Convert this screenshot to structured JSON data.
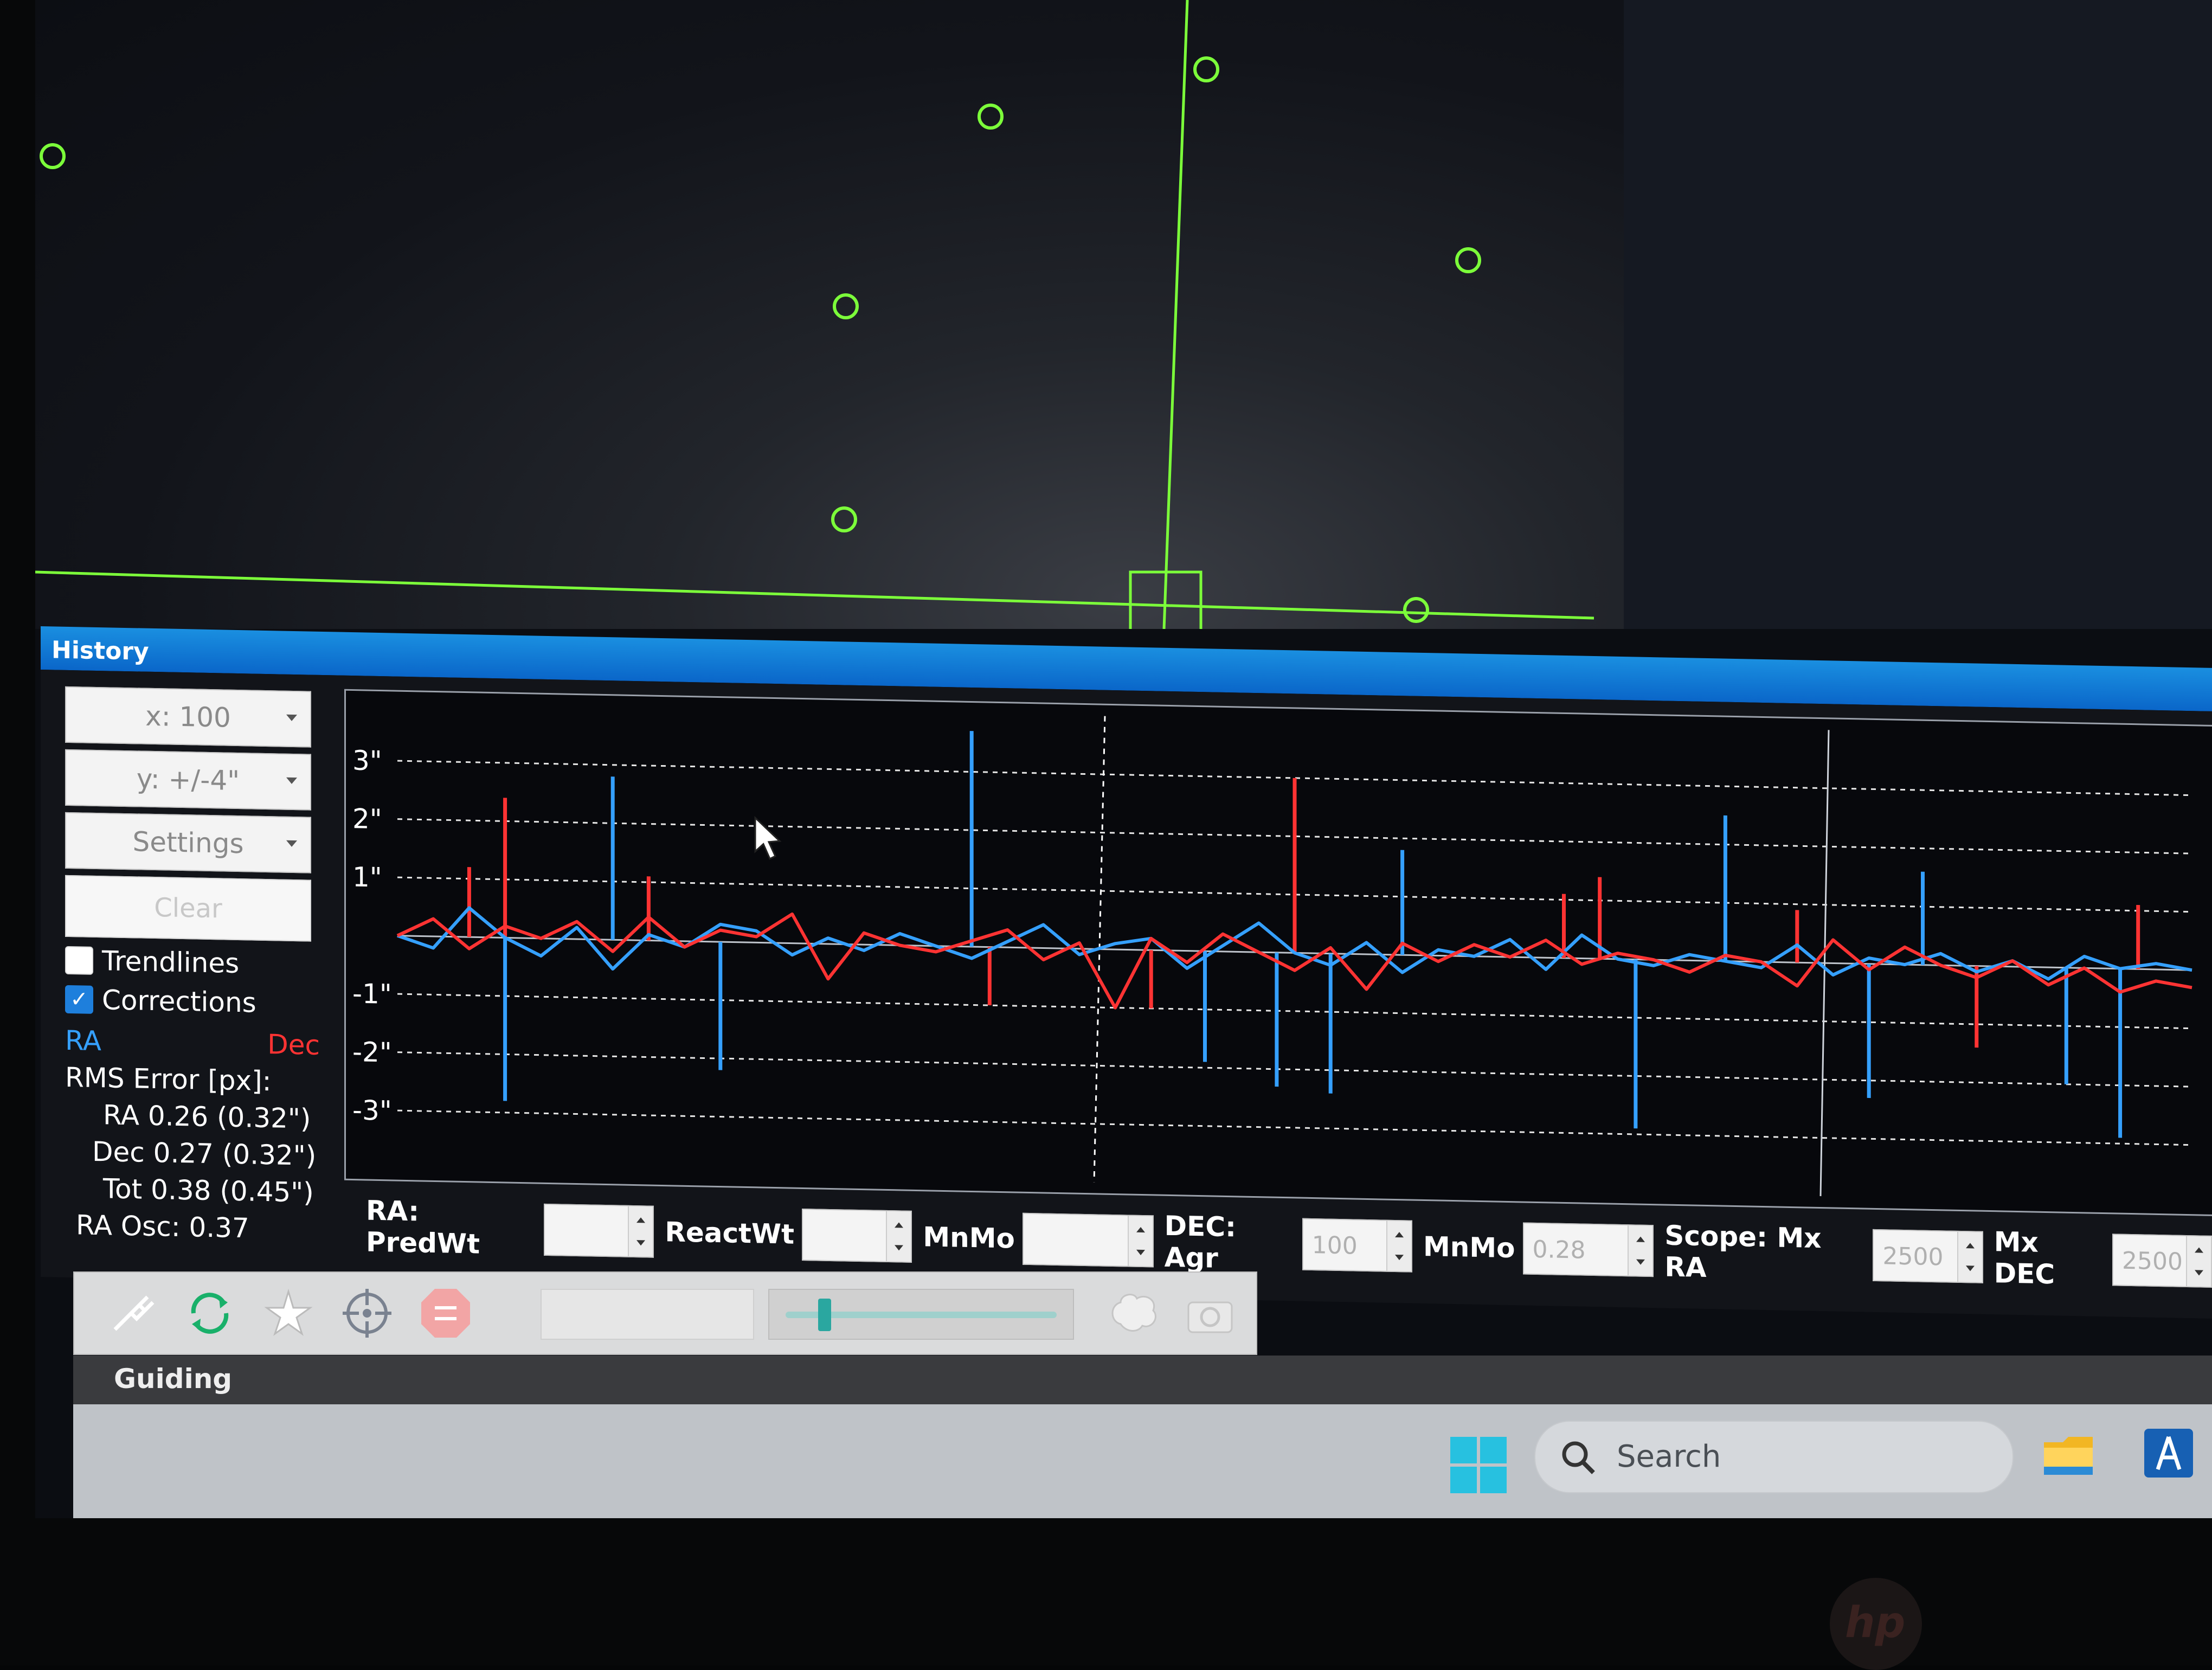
{
  "history": {
    "title": "History",
    "x_scale": "x: 100",
    "y_scale": "y: +/-4\"",
    "settings": "Settings",
    "clear": "Clear",
    "trendlines": {
      "label": "Trendlines",
      "checked": false
    },
    "corrections": {
      "label": "Corrections",
      "checked": true
    },
    "legend_ra": "RA",
    "legend_dec": "Dec",
    "rms_title": "RMS Error [px]:",
    "rms_ra": "RA 0.26 (0.32\")",
    "rms_dec": "Dec 0.27 (0.32\")",
    "rms_tot": "Tot 0.38 (0.45\")",
    "ra_osc": "RA Osc: 0.37"
  },
  "params": {
    "ra_label": "RA: PredWt",
    "ra_predwt": "",
    "reactwt_label": "ReactWt",
    "ra_reactwt": "",
    "ra_mnmo_label": "MnMo",
    "ra_mnmo": "",
    "dec_label": "DEC: Agr",
    "dec_agr": "100",
    "dec_mnmo_label": "MnMo",
    "dec_mnmo": "0.28",
    "scope_label": "Scope: Mx RA",
    "mx_ra": "2500",
    "mx_dec_label": "Mx DEC",
    "mx_dec": "2500"
  },
  "guiding": {
    "label": "Guiding"
  },
  "taskbar": {
    "search_label": "Search"
  },
  "icons": {
    "toolbar": [
      "usb-plug-icon",
      "loop-icon",
      "auto-select-star-icon",
      "guide-crosshair-icon",
      "stop-icon",
      "brain-icon",
      "camera-icon"
    ],
    "taskbar": [
      "windows-start-icon",
      "search-icon",
      "file-explorer-icon",
      "ascom-icon",
      "phd2-icon"
    ]
  },
  "colors": {
    "ra": "#35a0ff",
    "dec": "#ff3333",
    "overlay": "#7cff3a",
    "title_bar": "#0a66c9"
  },
  "chart_data": {
    "type": "line",
    "y_unit": "arcsec",
    "ytick_labels": [
      "3\"",
      "2\"",
      "1\"",
      "-1\"",
      "-2\"",
      "-3\""
    ],
    "ytick_values": [
      3,
      2,
      1,
      -1,
      -2,
      -3
    ],
    "ylim": [
      -4,
      4
    ],
    "xlim": [
      0,
      100
    ],
    "grid": true,
    "series": [
      {
        "key": "ra",
        "name": "RA",
        "x": [
          0,
          2,
          4,
          6,
          8,
          10,
          12,
          14,
          16,
          18,
          20,
          22,
          24,
          26,
          28,
          30,
          32,
          34,
          36,
          38,
          40,
          42,
          44,
          46,
          48,
          50,
          52,
          54,
          56,
          58,
          60,
          62,
          64,
          66,
          68,
          70,
          72,
          74,
          76,
          78,
          80,
          82,
          84,
          86,
          88,
          90,
          92,
          94,
          96,
          98,
          100
        ],
        "values": [
          0,
          -0.2,
          0.5,
          0,
          -0.3,
          0.2,
          -0.5,
          0.1,
          -0.1,
          0.3,
          0.2,
          -0.2,
          0.1,
          -0.1,
          0.2,
          0,
          -0.2,
          0.1,
          0.4,
          -0.1,
          0.1,
          0.2,
          -0.3,
          0.1,
          0.5,
          0,
          -0.2,
          0.2,
          -0.3,
          0.1,
          0,
          0.3,
          -0.2,
          0.4,
          0,
          -0.1,
          0.1,
          0,
          -0.1,
          0.3,
          -0.2,
          0.1,
          0,
          0.2,
          -0.1,
          0.1,
          -0.2,
          0.2,
          0,
          0.1,
          0
        ]
      },
      {
        "key": "dec",
        "name": "Dec",
        "x": [
          0,
          2,
          4,
          6,
          8,
          10,
          12,
          14,
          16,
          18,
          20,
          22,
          24,
          26,
          28,
          30,
          32,
          34,
          36,
          38,
          40,
          42,
          44,
          46,
          48,
          50,
          52,
          54,
          56,
          58,
          60,
          62,
          64,
          66,
          68,
          70,
          72,
          74,
          76,
          78,
          80,
          82,
          84,
          86,
          88,
          90,
          92,
          94,
          96,
          98,
          100
        ],
        "values": [
          0,
          0.3,
          -0.2,
          0.2,
          0,
          0.3,
          -0.2,
          0.4,
          -0.1,
          0.2,
          0.1,
          0.5,
          -0.6,
          0.2,
          0,
          -0.1,
          0.1,
          0.3,
          -0.2,
          0.1,
          -1,
          0.2,
          -0.2,
          0.3,
          0,
          -0.3,
          0.1,
          -0.6,
          0.2,
          -0.1,
          0.2,
          0,
          0.3,
          -0.1,
          0.1,
          0,
          -0.2,
          0.1,
          0,
          -0.4,
          0.4,
          -0.1,
          0.3,
          0,
          -0.2,
          0.1,
          -0.3,
          0,
          -0.4,
          -0.2,
          -0.3
        ]
      },
      {
        "key": "ra_corr",
        "name": "RA corrections",
        "x": [
          6,
          12,
          18,
          32,
          45,
          49,
          52,
          56,
          69,
          74,
          82,
          85,
          93,
          96
        ],
        "values": [
          -2.8,
          2.8,
          -2.2,
          3.7,
          -1.9,
          -2.3,
          -2.4,
          1.8,
          -2.9,
          2.5,
          -2.3,
          1.6,
          -2.0,
          -2.9
        ]
      },
      {
        "key": "dec_corr",
        "name": "Dec corrections",
        "x": [
          4,
          6,
          14,
          33,
          42,
          50,
          65,
          67,
          78,
          88,
          97
        ],
        "values": [
          1.2,
          2.4,
          1.1,
          -1.0,
          -1.0,
          3.0,
          1.1,
          1.4,
          0.9,
          -1.4,
          1.1
        ]
      }
    ]
  }
}
